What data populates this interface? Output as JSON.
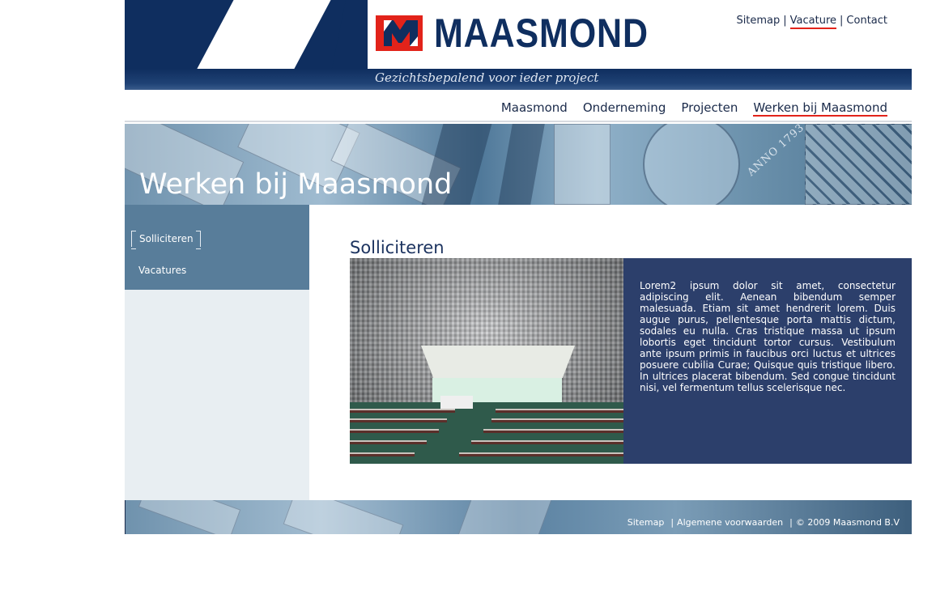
{
  "brand": {
    "name": "MAASMOND",
    "tagline": "Gezichtsbepalend voor ieder project",
    "color_primary": "#0f2e5f",
    "color_accent": "#e2231a"
  },
  "top_links": [
    {
      "label": "Sitemap"
    },
    {
      "label": "Vacature",
      "active": true
    },
    {
      "label": "Contact"
    }
  ],
  "top_sep": "|",
  "main_nav": [
    {
      "label": "Maasmond"
    },
    {
      "label": "Onderneming"
    },
    {
      "label": "Projecten"
    },
    {
      "label": "Werken bij Maasmond",
      "active": true
    }
  ],
  "banner": {
    "title": "Werken bij Maasmond",
    "engraving": "ANNO 1793"
  },
  "sub_nav": [
    {
      "label": "Solliciteren",
      "active": true
    },
    {
      "label": "Vacatures"
    }
  ],
  "content": {
    "heading": "Solliciteren",
    "body": "Lorem2 ipsum dolor sit amet, consectetur adipiscing elit. Aenean bibendum semper malesuada. Etiam sit amet hendrerit lorem. Duis augue purus, pellentesque porta mattis dictum, sodales eu nulla. Cras tristique massa ut ipsum lobortis eget tincidunt tortor cursus. Vestibulum ante ipsum primis in faucibus orci luctus et ultrices posuere cubilia Curae; Quisque quis tristique libero. In ultrices placerat bibendum. Sed congue tincidunt nisi, vel fermentum tellus scelerisque nec.",
    "textbox_color": "#2c3f6b"
  },
  "footer": {
    "sitemap": "Sitemap",
    "terms": "Algemene voorwaarden",
    "copyright": "© 2009 Maasmond B.V",
    "sep": "|"
  }
}
